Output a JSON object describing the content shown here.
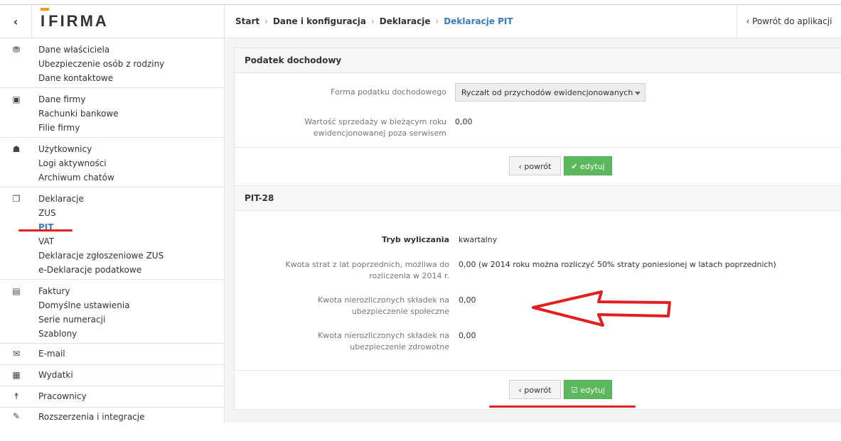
{
  "sidebar": {
    "collapse_glyph": "‹",
    "logo_text": "IFIRMA",
    "groups": [
      {
        "icon": "owner-bag-icon",
        "glyph": "⛃",
        "items": [
          "Dane właściciela",
          "Ubezpieczenie osób z rodziny",
          "Dane kontaktowe"
        ]
      },
      {
        "icon": "briefcase-icon",
        "glyph": "▣",
        "items": [
          "Dane firmy",
          "Rachunki bankowe",
          "Filie firmy"
        ]
      },
      {
        "icon": "users-icon",
        "glyph": "☗",
        "items": [
          "Użytkownicy",
          "Logi aktywności",
          "Archiwum chatów"
        ]
      },
      {
        "icon": "declarations-icon",
        "glyph": "❐",
        "items": [
          "Deklaracje",
          "ZUS",
          "PIT",
          "VAT",
          "Deklaracje zgłoszeniowe ZUS",
          "e-Deklaracje podatkowe"
        ]
      },
      {
        "icon": "document-icon",
        "glyph": "▤",
        "items": [
          "Faktury",
          "Domyślne ustawienia",
          "Serie numeracji",
          "Szablony"
        ]
      },
      {
        "icon": "envelope-icon",
        "glyph": "✉",
        "items": [
          "E-mail"
        ]
      },
      {
        "icon": "money-icon",
        "glyph": "▦",
        "items": [
          "Wydatki"
        ]
      },
      {
        "icon": "person-icon",
        "glyph": "☨",
        "items": [
          "Pracownicy"
        ]
      },
      {
        "icon": "plug-icon",
        "glyph": "✎",
        "items": [
          "Rozszerzenia i integracje"
        ]
      }
    ],
    "active_item": "PIT"
  },
  "breadcrumb": {
    "items": [
      "Start",
      "Dane i konfiguracja",
      "Deklaracje"
    ],
    "current": "Deklaracje PIT",
    "separator": "›"
  },
  "back_to_app": "‹ Powrót do aplikacji",
  "panel1": {
    "title": "Podatek dochodowy",
    "form_label": "Forma podatku dochodowego",
    "form_value": "Ryczałt od przychodów ewidencjonowanych",
    "sales_label": "Wartość sprzedaży w bieżącym roku ewidencjonowanej poza serwisem",
    "sales_value": "0,00",
    "back_label": "‹ powrót",
    "edit_label": "✔ edytuj"
  },
  "panel2": {
    "title": "PIT-28",
    "mode_label": "Tryb wyliczania",
    "mode_value": "kwartalny",
    "loss_label": "Kwota strat z lat poprzednich, możliwa do rozliczenia w 2014 r.",
    "loss_value": "0,00 (w 2014 roku można rozliczyć 50% straty poniesionej w latach poprzednich)",
    "social_label": "Kwota nierozliczonych składek na ubezpieczenie społeczne",
    "social_value": "0,00",
    "health_label": "Kwota nierozliczonych składek na ubezpieczenie zdrowotne",
    "health_value": "0,00",
    "back_label": "‹ powrót",
    "edit_label": "☑ edytuj"
  },
  "colors": {
    "accent": "#3a7bbd",
    "logo_bar": "#f39a1b",
    "edit_button": "#5cb85c",
    "annotation": "#e32020"
  }
}
